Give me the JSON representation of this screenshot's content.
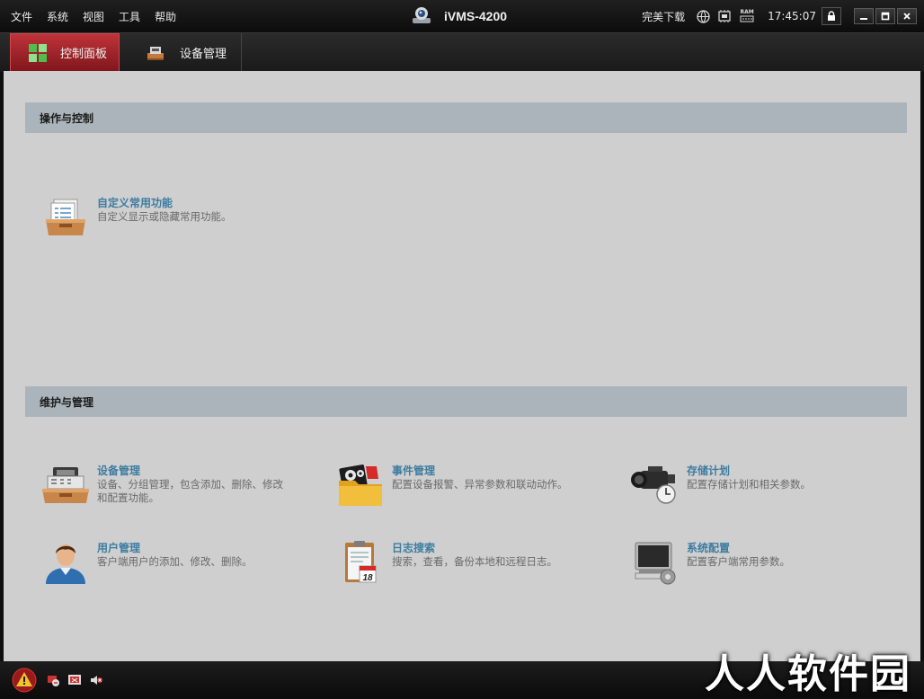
{
  "menu": [
    "文件",
    "系统",
    "视图",
    "工具",
    "帮助"
  ],
  "app_title": "iVMS-4200",
  "tray": {
    "user": "完美下载",
    "clock": "17:45:07",
    "ram_label": "RAM"
  },
  "tabs": [
    {
      "label": "控制面板",
      "active": true
    },
    {
      "label": "设备管理",
      "active": false
    }
  ],
  "sections": [
    {
      "title": "操作与控制",
      "items": [
        {
          "title": "自定义常用功能",
          "desc": "自定义显示或隐藏常用功能。",
          "icon": "customize-icon"
        }
      ]
    },
    {
      "title": "维护与管理",
      "items": [
        {
          "title": "设备管理",
          "desc": "设备、分组管理，包含添加、删除、修改和配置功能。",
          "icon": "device-icon"
        },
        {
          "title": "事件管理",
          "desc": "配置设备报警、异常参数和联动动作。",
          "icon": "event-folder-icon"
        },
        {
          "title": "存储计划",
          "desc": "配置存储计划和相关参数。",
          "icon": "camera-clock-icon"
        },
        {
          "title": "用户管理",
          "desc": "客户端用户的添加、修改、删除。",
          "icon": "user-icon"
        },
        {
          "title": "日志搜索",
          "desc": "搜索，查看，备份本地和远程日志。",
          "icon": "log-clipboard-icon",
          "badge": "18"
        },
        {
          "title": "系统配置",
          "desc": "配置客户端常用参数。",
          "icon": "monitor-gear-icon"
        }
      ]
    }
  ],
  "watermark": "人人软件园",
  "colors": {
    "accent_tab": "#b52a30",
    "section_header": "#aab4ba",
    "item_title": "#3d7ca0",
    "panel_bg": "#cfcfcf"
  }
}
